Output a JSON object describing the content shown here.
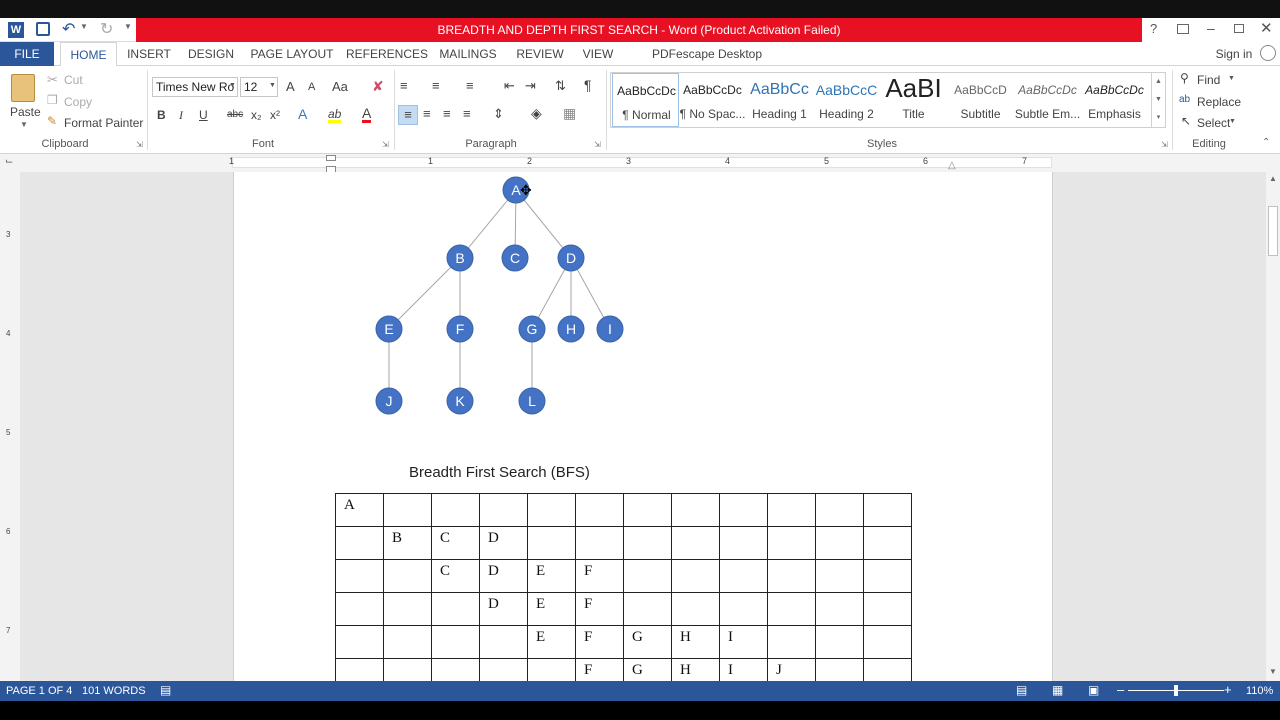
{
  "window": {
    "title": "BREADTH AND DEPTH FIRST SEARCH -  Word (Product Activation Failed)",
    "help": "?",
    "sign_in": "Sign in"
  },
  "tabs": [
    "FILE",
    "HOME",
    "INSERT",
    "DESIGN",
    "PAGE LAYOUT",
    "REFERENCES",
    "MAILINGS",
    "REVIEW",
    "VIEW",
    "PDFescape Desktop Creator"
  ],
  "clipboard": {
    "paste": "Paste",
    "cut": "Cut",
    "copy": "Copy",
    "format_painter": "Format Painter",
    "label": "Clipboard"
  },
  "font": {
    "name": "Times New Ro",
    "size": "12",
    "label": "Font",
    "grow": "A",
    "shrink": "A",
    "case": "Aa",
    "bold": "B",
    "italic": "I",
    "underline": "U",
    "strike": "abc",
    "sub": "x₂",
    "sup": "x²",
    "effects": "A",
    "highlight": "ab",
    "color": "A"
  },
  "paragraph": {
    "label": "Paragraph",
    "pilcrow": "¶"
  },
  "styles": {
    "label": "Styles",
    "items": [
      {
        "preview": "AaBbCcDc",
        "name": "¶ Normal"
      },
      {
        "preview": "AaBbCcDc",
        "name": "¶ No Spac..."
      },
      {
        "preview": "AaBbCc",
        "name": "Heading 1"
      },
      {
        "preview": "AaBbCcC",
        "name": "Heading 2"
      },
      {
        "preview": "AaBI",
        "name": "Title"
      },
      {
        "preview": "AaBbCcD",
        "name": "Subtitle"
      },
      {
        "preview": "AaBbCcDc",
        "name": "Subtle Em..."
      },
      {
        "preview": "AaBbCcDc",
        "name": "Emphasis"
      }
    ]
  },
  "editing": {
    "find": "Find",
    "replace": "Replace",
    "select": "Select",
    "label": "Editing"
  },
  "ruler_numbers": [
    "1",
    "1",
    "2",
    "3",
    "4",
    "5",
    "6",
    "7"
  ],
  "vruler_numbers": [
    "3",
    "4",
    "5",
    "6",
    "7"
  ],
  "tree": {
    "nodes": [
      {
        "label": "A"
      },
      {
        "label": "B"
      },
      {
        "label": "C"
      },
      {
        "label": "D"
      },
      {
        "label": "E"
      },
      {
        "label": "F"
      },
      {
        "label": "G"
      },
      {
        "label": "H"
      },
      {
        "label": "I"
      },
      {
        "label": "J"
      },
      {
        "label": "K"
      },
      {
        "label": "L"
      }
    ],
    "edges": [
      [
        "A",
        "B"
      ],
      [
        "A",
        "C"
      ],
      [
        "A",
        "D"
      ],
      [
        "B",
        "E"
      ],
      [
        "B",
        "F"
      ],
      [
        "D",
        "G"
      ],
      [
        "D",
        "H"
      ],
      [
        "D",
        "I"
      ],
      [
        "E",
        "J"
      ],
      [
        "F",
        "K"
      ],
      [
        "G",
        "L"
      ]
    ],
    "node_color": "#4472c4"
  },
  "bfs": {
    "heading": "Breadth First Search (BFS)",
    "rows": [
      [
        "A",
        "",
        "",
        "",
        "",
        "",
        "",
        "",
        "",
        "",
        "",
        ""
      ],
      [
        "",
        "B",
        "C",
        "D",
        "",
        "",
        "",
        "",
        "",
        "",
        "",
        ""
      ],
      [
        "",
        "",
        "C",
        "D",
        "E",
        "F",
        "",
        "",
        "",
        "",
        "",
        ""
      ],
      [
        "",
        "",
        "",
        "D",
        "E",
        "F",
        "",
        "",
        "",
        "",
        "",
        ""
      ],
      [
        "",
        "",
        "",
        "",
        "E",
        "F",
        "G",
        "H",
        "I",
        "",
        "",
        ""
      ],
      [
        "",
        "",
        "",
        "",
        "",
        "F",
        "G",
        "H",
        "I",
        "J",
        "",
        ""
      ]
    ]
  },
  "status": {
    "page": "PAGE 1 OF 4",
    "words": "101 WORDS",
    "zoom": "110%"
  },
  "colors": {
    "accent": "#2b579a",
    "title_bar": "#e81123"
  }
}
